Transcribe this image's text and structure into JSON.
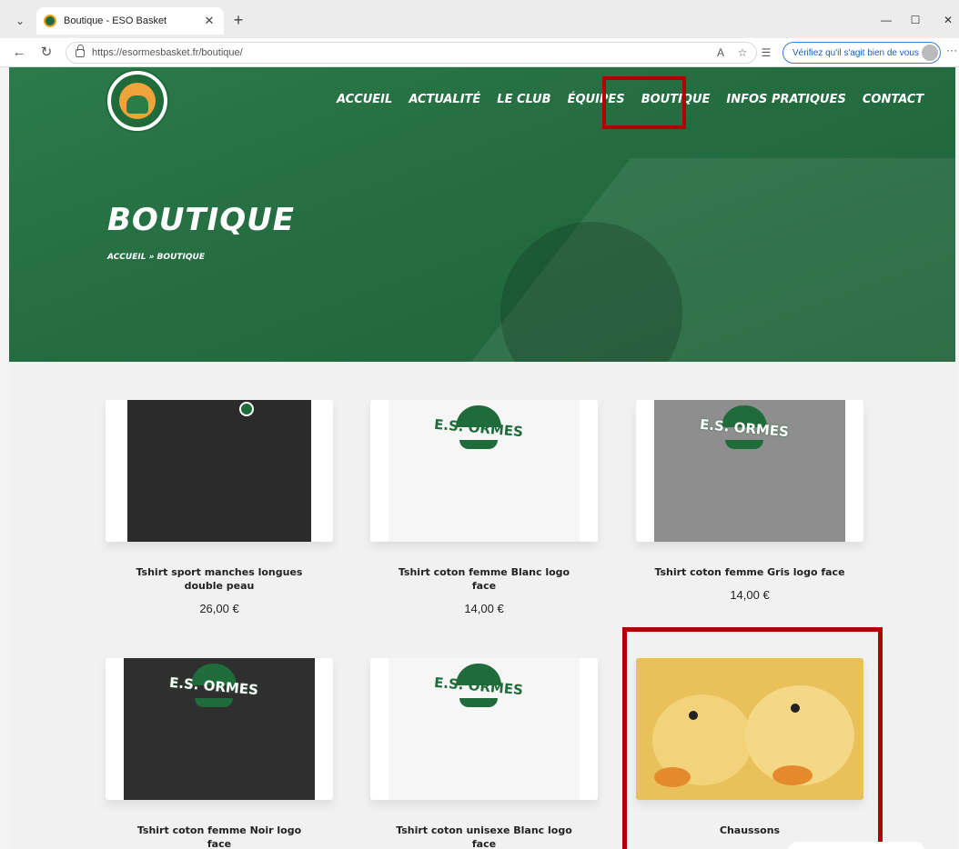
{
  "browser": {
    "tab_title": "Boutique - ESO Basket",
    "url": "https://esormesbasket.fr/boutique/",
    "verify_text": "Vérifiez qu'il s'agit bien de vous"
  },
  "site": {
    "nav": [
      "ACCUEIL",
      "ACTUALITÉ",
      "LE CLUB",
      "ÉQUIPES",
      "BOUTIQUE",
      "INFOS PRATIQUES",
      "CONTACT"
    ],
    "hero_title": "BOUTIQUE",
    "breadcrumb": "ACCUEIL » BOUTIQUE",
    "emblem_text": "E.S. ORMES"
  },
  "products": [
    {
      "name": "Tshirt sport manches longues double peau",
      "price": "26,00 €",
      "color": "#2b2b2b"
    },
    {
      "name": "Tshirt coton femme Blanc logo face",
      "price": "14,00 €",
      "color": "#f6f6f6"
    },
    {
      "name": "Tshirt coton femme Gris logo face",
      "price": "14,00 €",
      "color": "#8e8e8e"
    },
    {
      "name": "Tshirt coton femme Noir logo face",
      "price": "",
      "color": "#2f2f2f"
    },
    {
      "name": "Tshirt coton unisexe Blanc logo face",
      "price": "",
      "color": "#f6f6f6"
    },
    {
      "name": "Chaussons",
      "price": "",
      "color": "#e8c15a"
    }
  ],
  "colors": {
    "brand_green": "#1f6b3a",
    "highlight_red": "#b00000"
  }
}
